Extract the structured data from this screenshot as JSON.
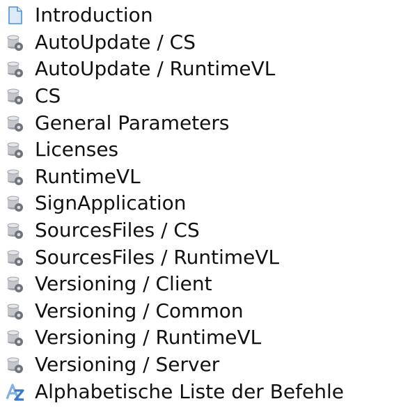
{
  "tree": {
    "items": [
      {
        "label": "Introduction",
        "icon": "document-icon"
      },
      {
        "label": "AutoUpdate / CS",
        "icon": "database-gear-icon"
      },
      {
        "label": "AutoUpdate / RuntimeVL",
        "icon": "database-gear-icon"
      },
      {
        "label": "CS",
        "icon": "database-gear-icon"
      },
      {
        "label": "General Parameters",
        "icon": "database-gear-icon"
      },
      {
        "label": "Licenses",
        "icon": "database-gear-icon"
      },
      {
        "label": "RuntimeVL",
        "icon": "database-gear-icon"
      },
      {
        "label": "SignApplication",
        "icon": "database-gear-icon"
      },
      {
        "label": "SourcesFiles / CS",
        "icon": "database-gear-icon"
      },
      {
        "label": "SourcesFiles / RuntimeVL",
        "icon": "database-gear-icon"
      },
      {
        "label": "Versioning / Client",
        "icon": "database-gear-icon"
      },
      {
        "label": "Versioning / Common",
        "icon": "database-gear-icon"
      },
      {
        "label": "Versioning / RuntimeVL",
        "icon": "database-gear-icon"
      },
      {
        "label": "Versioning / Server",
        "icon": "database-gear-icon"
      },
      {
        "label": "Alphabetische Liste der Befehle",
        "icon": "alphabet-az-icon"
      }
    ]
  },
  "colors": {
    "text": "#111111",
    "doc_blue": "#4a90d9",
    "az_blue": "#3a78c9",
    "cylinder_gray": "#b8bcc2"
  }
}
